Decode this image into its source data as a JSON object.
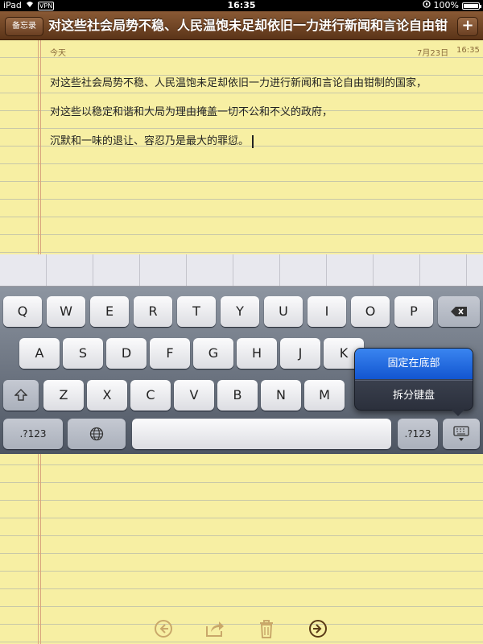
{
  "status_bar": {
    "device": "iPad",
    "vpn": "VPN",
    "time": "16:35",
    "battery": "100%"
  },
  "header": {
    "back_label": "备忘录",
    "title": "对这些社会局势不稳、人民温饱未足却依旧一力进行新闻和言论自由钳",
    "add_label": "+"
  },
  "note": {
    "day_label": "今天",
    "date": "7月23日",
    "time": "16:35",
    "lines": [
      "对这些社会局势不稳、人民温饱未足却依旧一力进行新闻和言论自由钳制的国家，",
      "对这些以稳定和谐和大局为理由掩盖一切不公和不义的政府，",
      "沉默和一味的退让、容忍乃是最大的罪愆。"
    ]
  },
  "keyboard": {
    "row1": [
      "Q",
      "W",
      "E",
      "R",
      "T",
      "Y",
      "U",
      "I",
      "O",
      "P"
    ],
    "row2": [
      "A",
      "S",
      "D",
      "F",
      "G",
      "H",
      "J",
      "K"
    ],
    "row3": [
      "Z",
      "X",
      "C",
      "V",
      "B",
      "N",
      "M"
    ],
    "mode_left": ".?123",
    "mode_right": ".?123"
  },
  "keyboard_menu": {
    "items": [
      "固定在底部",
      "拆分键盘"
    ],
    "selected": "固定在底部"
  },
  "toolbar": {
    "icons": [
      "previous-icon",
      "share-icon",
      "trash-icon",
      "next-icon"
    ]
  },
  "colors": {
    "paper": "#f7efa3",
    "header": "#6a3f22",
    "menu_selected": "#1f6fe0"
  }
}
